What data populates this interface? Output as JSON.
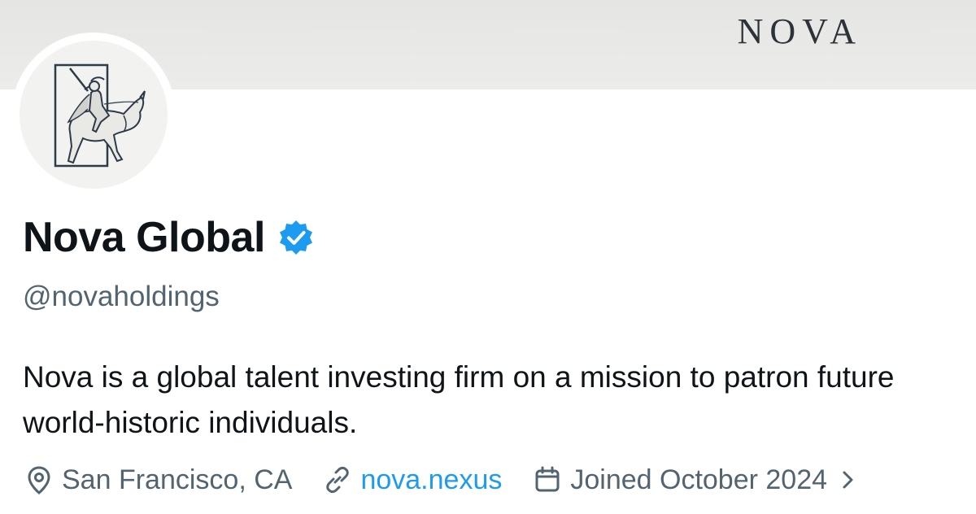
{
  "banner": {
    "brand_text": "NOVA"
  },
  "profile": {
    "display_name": "Nova Global",
    "verified": true,
    "handle": "@novaholdings",
    "bio": "Nova is a global talent investing firm on a mission to patron future world-historic individuals."
  },
  "meta": {
    "location": "San Francisco, CA",
    "website": "nova.nexus",
    "joined": "Joined October 2024"
  },
  "icons": {
    "verified": "verified-badge-icon",
    "location": "location-pin-icon",
    "link": "link-icon",
    "calendar": "calendar-icon",
    "chevron": "chevron-right-icon"
  },
  "colors": {
    "accent": "#1d9bf0",
    "text_primary": "#0f1419",
    "text_secondary": "#536471",
    "banner": "#e8e8e6"
  }
}
